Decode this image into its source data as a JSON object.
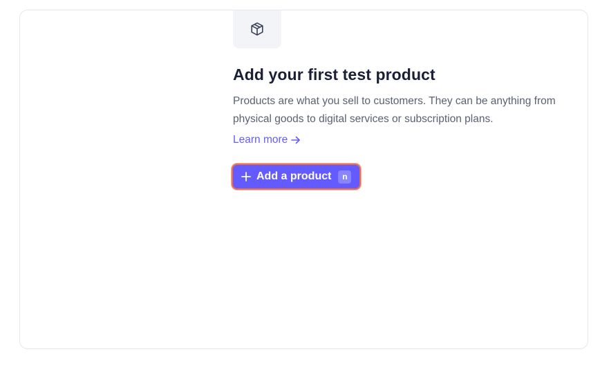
{
  "empty_state": {
    "icon": "box-icon",
    "title": "Add your first test product",
    "description": "Products are what you sell to customers. They can be anything from physical goods to digital services or subscription plans.",
    "learn_more_label": "Learn more",
    "learn_more_arrow": "arrow-right-icon"
  },
  "primary_action": {
    "icon": "plus-icon",
    "label": "Add a product",
    "shortcut_key": "n"
  },
  "colors": {
    "accent": "#635bff",
    "focus_ring": "#e8704f",
    "title": "#1a1f36",
    "body_text": "#596171",
    "icon_tile_bg": "#f2f4f7",
    "card_border": "#e3e8ee"
  }
}
